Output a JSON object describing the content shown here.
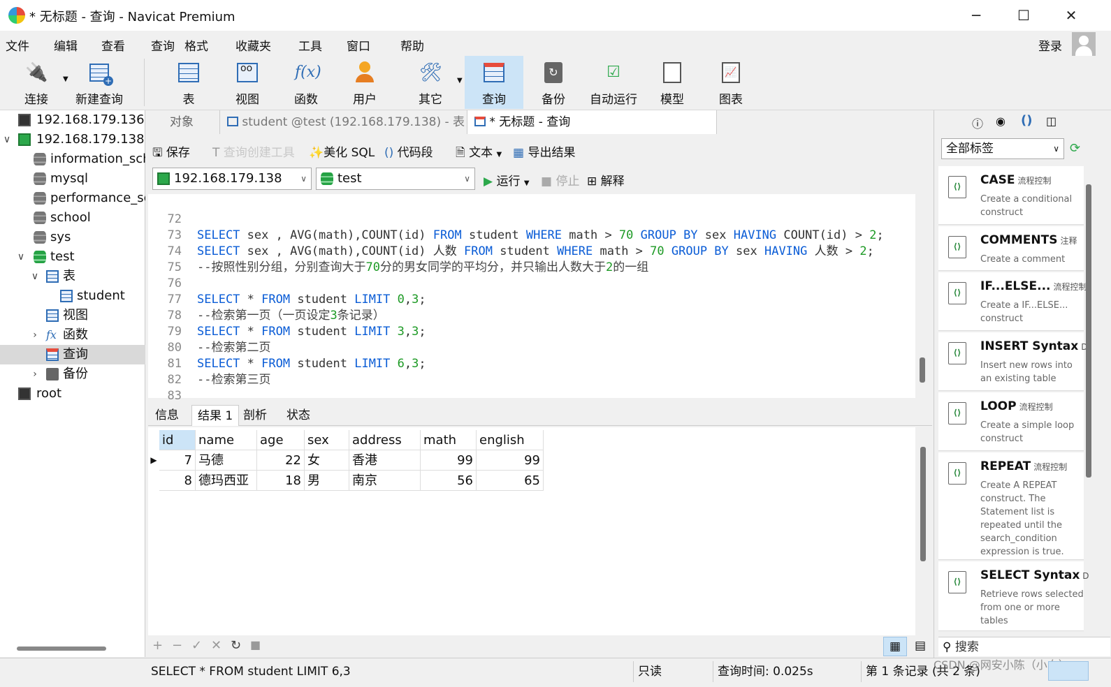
{
  "window": {
    "title": "* 无标题 - 查询 - Navicat Premium",
    "minimize": "─",
    "maximize": "☐",
    "close": "✕"
  },
  "menu": [
    "文件",
    "编辑",
    "查看",
    "查询",
    "格式",
    "收藏夹",
    "工具",
    "窗口",
    "帮助"
  ],
  "login": "登录",
  "toolbar": {
    "connect": "连接",
    "new_query": "新建查询",
    "table": "表",
    "view": "视图",
    "function": "函数",
    "user": "用户",
    "other": "其它",
    "query": "查询",
    "backup": "备份",
    "auto_run": "自动运行",
    "model": "模型",
    "chart": "图表"
  },
  "nav": {
    "items": [
      {
        "label": "192.168.179.136"
      },
      {
        "label": "192.168.179.138"
      },
      {
        "label": "information_sch"
      },
      {
        "label": "mysql"
      },
      {
        "label": "performance_sc"
      },
      {
        "label": "school"
      },
      {
        "label": "sys"
      },
      {
        "label": "test"
      },
      {
        "label": "表"
      },
      {
        "label": "student"
      },
      {
        "label": "视图"
      },
      {
        "label": "函数"
      },
      {
        "label": "查询"
      },
      {
        "label": "备份"
      },
      {
        "label": "root"
      }
    ]
  },
  "tabs": {
    "objects": "对象",
    "student": "student @test (192.168.179.138) - 表",
    "query": "* 无标题 - 查询"
  },
  "editor_toolbar": {
    "save": "保存",
    "query_builder": "查询创建工具",
    "beautify": "美化 SQL",
    "snippet": "代码段",
    "text": "文本",
    "export": "导出结果"
  },
  "connection": {
    "server": "192.168.179.138",
    "database": "test",
    "run": "运行",
    "stop": "停止",
    "explain": "解释"
  },
  "code": [
    {
      "n": "72"
    },
    {
      "n": "73"
    },
    {
      "n": "74"
    },
    {
      "n": "75"
    },
    {
      "n": "76"
    },
    {
      "n": "77"
    },
    {
      "n": "78"
    },
    {
      "n": "79"
    },
    {
      "n": "80"
    },
    {
      "n": "81"
    },
    {
      "n": "82"
    },
    {
      "n": "83"
    }
  ],
  "code_text": {
    "l72a": "SELECT",
    "l72b": " sex , AVG(math),COUNT(id) ",
    "l72c": "FROM",
    "l72d": " student ",
    "l72e": "WHERE",
    "l72f": " math > ",
    "l72g": "70",
    "l72h": " ",
    "l72i": "GROUP BY",
    "l72j": " sex ",
    "l72k": "HAVING",
    "l72l": " COUNT(id) > ",
    "l72m": "2",
    "l72n": ";",
    "l73a": "SELECT",
    "l73b": " sex , AVG(math),COUNT(id) 人数 ",
    "l73c": "FROM",
    "l73d": " student ",
    "l73e": "WHERE",
    "l73f": " math > ",
    "l73g": "70",
    "l73h": " ",
    "l73i": "GROUP BY",
    "l73j": " sex ",
    "l73k": "HAVING",
    "l73l": " 人数 > ",
    "l73m": "2",
    "l73n": ";",
    "l74a": "--按照性别分组，分别查询大于",
    "l74b": "70",
    "l74c": "分的男女同学的平均分，并只输出人数大于",
    "l74d": "2",
    "l74e": "的一组",
    "l76a": "SELECT",
    "l76b": " * ",
    "l76c": "FROM",
    "l76d": " student ",
    "l76e": "LIMIT",
    "l76f": " ",
    "l76g": "0",
    "l76h": ",",
    "l76i": "3",
    "l76j": ";",
    "l77a": "--检索第一页（一页设定",
    "l77b": "3",
    "l77c": "条记录）",
    "l78a": "SELECT",
    "l78b": " * ",
    "l78c": "FROM",
    "l78d": " student ",
    "l78e": "LIMIT",
    "l78f": " ",
    "l78g": "3",
    "l78h": ",",
    "l78i": "3",
    "l78j": ";",
    "l79a": "--检索第二页",
    "l80a": "SELECT",
    "l80b": " * ",
    "l80c": "FROM",
    "l80d": " student ",
    "l80e": "LIMIT",
    "l80f": " ",
    "l80g": "6",
    "l80h": ",",
    "l80i": "3",
    "l80j": ";",
    "l81a": "--检索第三页"
  },
  "result_tabs": [
    "信息",
    "结果 1",
    "剖析",
    "状态"
  ],
  "grid": {
    "columns": [
      "id",
      "name",
      "age",
      "sex",
      "address",
      "math",
      "english"
    ],
    "rows": [
      [
        "7",
        "马德",
        "22",
        "女",
        "香港",
        "99",
        "99"
      ],
      [
        "8",
        "德玛西亚",
        "18",
        "男",
        "南京",
        "56",
        "65"
      ]
    ]
  },
  "bottom_tools": [
    "+",
    "−",
    "✓",
    "✕",
    "↻",
    "■"
  ],
  "status": {
    "sql": "SELECT * FROM student LIMIT 6,3",
    "readonly": "只读",
    "time": "查询时间: 0.025s",
    "record": "第 1 条记录 (共 2 条)",
    "watermark": "CSDN @网安小陈（小白）"
  },
  "right_panel": {
    "filter": "全部标签",
    "search": "搜索",
    "snippets": [
      {
        "title": "CASE",
        "tag": "流程控制",
        "desc": "Create a conditional construct"
      },
      {
        "title": "COMMENTS",
        "tag": "注释",
        "desc": "Create a comment"
      },
      {
        "title": "IF...ELSE...",
        "tag": "流程控制",
        "desc": "Create a IF...ELSE... construct"
      },
      {
        "title": "INSERT Syntax",
        "tag": "D",
        "desc": "Insert new rows into an existing table"
      },
      {
        "title": "LOOP",
        "tag": "流程控制",
        "desc": "Create a simple loop construct"
      },
      {
        "title": "REPEAT",
        "tag": "流程控制",
        "desc": "Create A REPEAT construct. The Statement list is repeated until the search_condition expression is true."
      },
      {
        "title": "SELECT Syntax",
        "tag": "D",
        "desc": "Retrieve rows selected from one or more tables"
      }
    ]
  },
  "colors": {
    "keyword": "#0a5cd6",
    "number": "#1d9a25",
    "accent": "#cce4f7"
  }
}
